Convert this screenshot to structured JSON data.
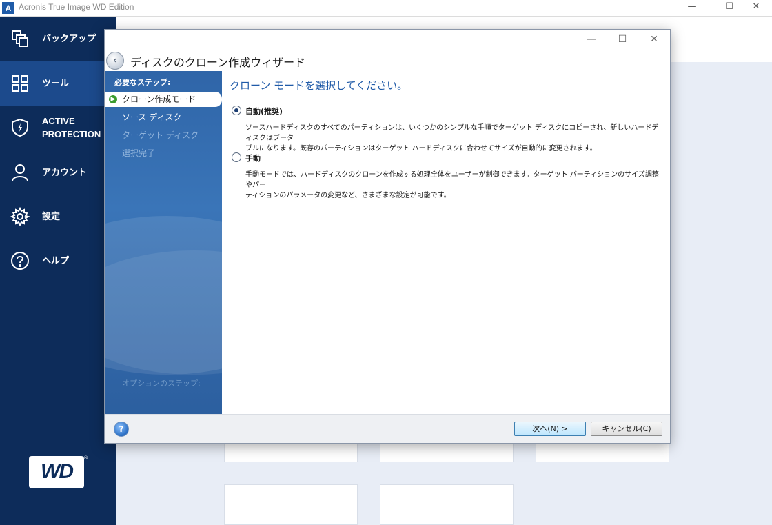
{
  "app": {
    "logo_letter": "A",
    "title": "Acronis True Image WD Edition",
    "minimize": "—",
    "maximize": "☐",
    "close": "✕"
  },
  "sidebar": {
    "items": [
      {
        "label": "バックアップ",
        "icon": "backup-icon"
      },
      {
        "label": "ツール",
        "icon": "tools-grid-icon",
        "active": true
      },
      {
        "label_line1": "ACTIVE",
        "label_line2": "PROTECTION",
        "icon": "shield-icon"
      },
      {
        "label": "アカウント",
        "icon": "account-icon"
      },
      {
        "label": "設定",
        "icon": "gear-icon"
      },
      {
        "label": "ヘルプ",
        "icon": "help-icon"
      }
    ],
    "brand_logo": "WD",
    "brand_mark": "®"
  },
  "dialog": {
    "controls": {
      "minimize": "—",
      "maximize": "☐",
      "close": "✕"
    },
    "back_glyph": "‹",
    "title": "ディスクのクローン作成ウィザード",
    "steps_header": "必要なステップ:",
    "steps": [
      {
        "label": "クローン作成モード",
        "state": "current"
      },
      {
        "label": "ソース ディスク",
        "state": "link"
      },
      {
        "label": "ターゲット ディスク",
        "state": "disabled"
      },
      {
        "label": "選択完了",
        "state": "disabled"
      }
    ],
    "steps_footer": "オプションのステップ:",
    "heading": "クローン モードを選択してください。",
    "options": [
      {
        "label": "自動(推奨)",
        "checked": true,
        "desc_line1": "ソースハードディスクのすべてのパーティションは、いくつかのシンプルな手順でターゲット ディスクにコピーされ、新しいハードディスクはブータ",
        "desc_line2": "ブルになります。既存のパーティションはターゲット ハードディスクに合わせてサイズが自動的に変更されます。"
      },
      {
        "label": "手動",
        "checked": false,
        "desc_line1": "手動モードでは、ハードディスクのクローンを作成する処理全体をユーザーが制御できます。ターゲット パーティションのサイズ調整やパー",
        "desc_line2": "ティションのパラメータの変更など、さまざまな設定が可能です。"
      }
    ],
    "help_glyph": "?",
    "next_button": "次へ(N) >",
    "cancel_button": "キャンセル(C)"
  },
  "colors": {
    "sidebar_bg": "#0d2c5a",
    "sidebar_active": "#1c4a8c",
    "accent_blue": "#1f5aa8",
    "steps_panel": "#2f65a8"
  }
}
